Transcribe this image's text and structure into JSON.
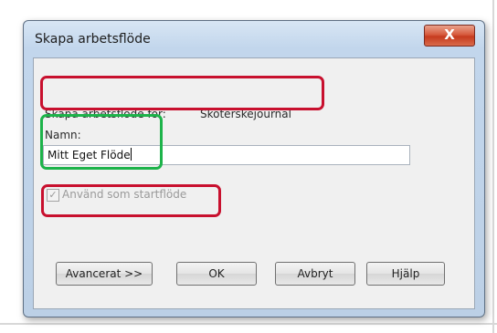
{
  "window": {
    "title": "Skapa arbetsflöde",
    "close_label": "X"
  },
  "form": {
    "create_for_label": "Skapa arbetsflöde för:",
    "create_for_value": "Sköterskejournal",
    "name_label": "Namn:",
    "name_value": "Mitt Eget Flöde",
    "use_as_start_label": "Använd som startflöde",
    "use_as_start_checked": true,
    "use_as_start_enabled": false
  },
  "buttons": {
    "advanced_label": "Avancerat >>",
    "ok_label": "OK",
    "cancel_label": "Avbryt",
    "help_label": "Hjälp"
  },
  "highlights": {
    "red_color": "#c8102e",
    "green_color": "#1db34a"
  }
}
